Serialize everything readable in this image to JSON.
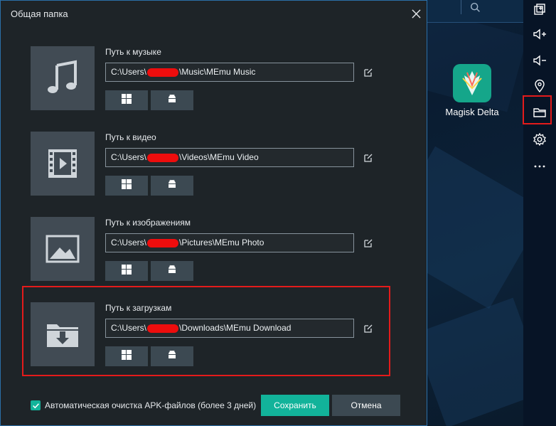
{
  "dialog": {
    "title": "Общая папка",
    "rows": [
      {
        "label": "Путь к музыке",
        "prefix": "C:\\Users\\",
        "suffix": "\\Music\\MEmu Music",
        "thumb_icon": "music-icon"
      },
      {
        "label": "Путь к видео",
        "prefix": "C:\\Users\\",
        "suffix": "\\Videos\\MEmu Video",
        "thumb_icon": "video-icon"
      },
      {
        "label": "Путь к изображениям",
        "prefix": "C:\\Users\\",
        "suffix": "\\Pictures\\MEmu Photo",
        "thumb_icon": "image-icon"
      },
      {
        "label": "Путь к загрузкам",
        "prefix": "C:\\Users\\",
        "suffix": "\\Downloads\\MEmu Download",
        "thumb_icon": "download-folder-icon"
      }
    ],
    "auto_clean": {
      "label": "Автоматическая очистка APK-файлов (более 3 дней)",
      "checked": true
    },
    "save_label": "Сохранить",
    "cancel_label": "Отмена"
  },
  "desktop": {
    "app_label": "Magisk Delta"
  },
  "toolbar": {
    "items": [
      "multi-window-icon",
      "volume-up-icon",
      "volume-down-icon",
      "location-icon",
      "shared-folder-icon",
      "settings-icon",
      "more-icon"
    ]
  },
  "colors": {
    "accent": "#12b39a",
    "highlight": "#e41b1b",
    "dialog_bg": "#1e2428",
    "tile_bg": "#414b54"
  }
}
